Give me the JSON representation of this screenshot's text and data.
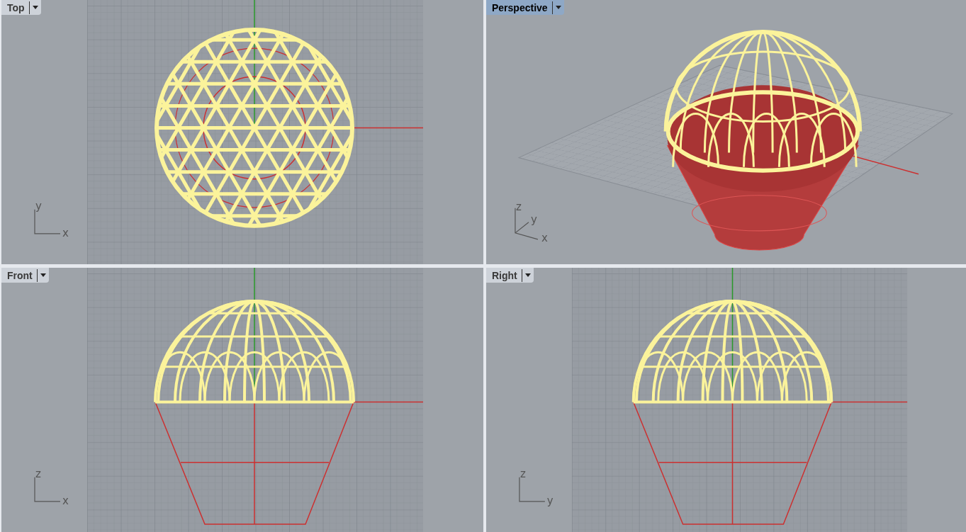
{
  "viewports": [
    {
      "label": "Top",
      "selected": false,
      "kind": "top",
      "axes": [
        "y",
        "x"
      ]
    },
    {
      "label": "Perspective",
      "selected": true,
      "kind": "perspective",
      "axes": [
        "z",
        "y",
        "x"
      ]
    },
    {
      "label": "Front",
      "selected": false,
      "kind": "front",
      "axes": [
        "z",
        "x"
      ]
    },
    {
      "label": "Right",
      "selected": false,
      "kind": "right",
      "axes": [
        "z",
        "y"
      ]
    }
  ]
}
